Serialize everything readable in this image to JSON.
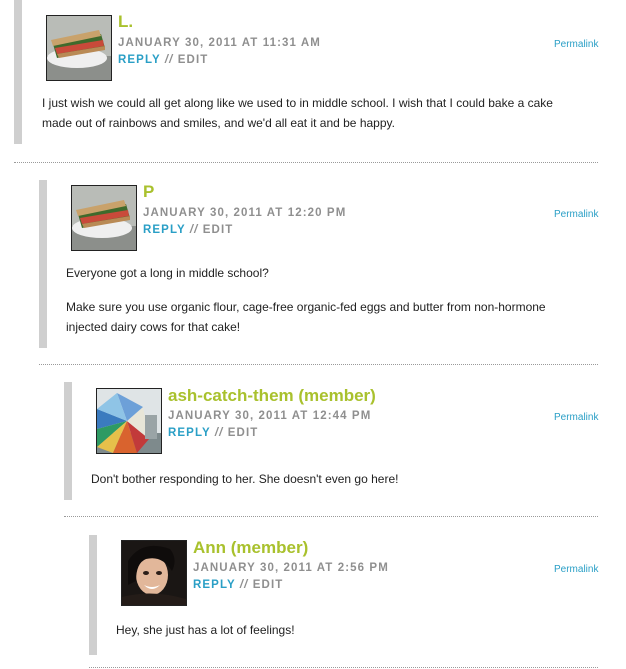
{
  "comments": [
    {
      "author": "L.",
      "date": "JANUARY 30, 2011 AT 11:31 AM",
      "reply": "REPLY",
      "separator": "//",
      "edit": "EDIT",
      "permalink": "Permalink",
      "paragraphs": [
        "I just wish we could all get along like we used to in middle school. I wish that I could bake a cake made out of rainbows and smiles, and we'd all eat it and be happy."
      ]
    },
    {
      "author": "P",
      "date": "JANUARY 30, 2011 AT 12:20 PM",
      "reply": "REPLY",
      "separator": "//",
      "edit": "EDIT",
      "permalink": "Permalink",
      "paragraphs": [
        "Everyone got a long in middle school?",
        "Make sure you use organic flour, cage-free organic-fed eggs and butter from non-hormone injected dairy cows for that cake!"
      ]
    },
    {
      "author": "ash-catch-them (member)",
      "date": "JANUARY 30, 2011 AT 12:44 PM",
      "reply": "REPLY",
      "separator": "//",
      "edit": "EDIT",
      "permalink": "Permalink",
      "paragraphs": [
        "Don't bother responding to her. She doesn't even go here!"
      ]
    },
    {
      "author": "Ann (member)",
      "date": "JANUARY 30, 2011 AT 2:56 PM",
      "reply": "REPLY",
      "separator": "//",
      "edit": "EDIT",
      "permalink": "Permalink",
      "paragraphs": [
        "Hey, she just has a lot of feelings!"
      ]
    }
  ],
  "colors": {
    "author": "#a9c12d",
    "link": "#2a9fc6",
    "meta": "#8f8f8f",
    "thread_bar": "#cfcfcf"
  }
}
